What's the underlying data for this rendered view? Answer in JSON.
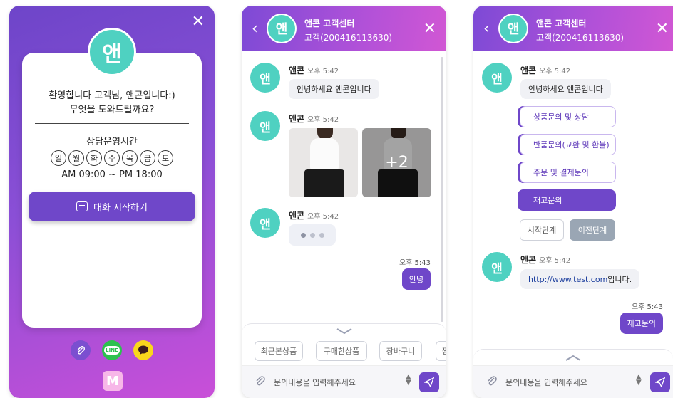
{
  "welcome_panel": {
    "avatar": "앤",
    "greeting_line1": "환영합니다 고객님, 앤콘입니다:)",
    "greeting_line2": "무엇을 도와드릴까요?",
    "hours_title": "상담운영시간",
    "days": [
      "일",
      "월",
      "화",
      "수",
      "목",
      "금",
      "토"
    ],
    "hours": "AM 09:00 ~ PM 18:00",
    "start_button": "대화 시작하기",
    "close_icon": "close-icon",
    "line_label": "LINE",
    "logo": "M"
  },
  "chat_header": {
    "avatar": "앤",
    "name": "앤콘 고객센터",
    "sub": "고객(200416113630)"
  },
  "chat1": {
    "sender": "앤콘",
    "m1_time": "오후 5:42",
    "m1_text": "안녕하세요 앤콘입니다",
    "m2_time": "오후 5:42",
    "more_photos": "+2",
    "m3_time": "오후 5:42",
    "mine_time": "오후 5:43",
    "mine_text": "안녕",
    "quick_chips": [
      "최근본상품",
      "구매한상품",
      "장바구니",
      "찜"
    ],
    "input_placeholder": "문의내용을 입력해주세요"
  },
  "chat2": {
    "sender": "앤콘",
    "m1_time": "오후 5:42",
    "m1_text": "안녕하세요 앤콘입니다",
    "options": [
      "상품문의 및 상담",
      "반품문의(교환 및 환불)",
      "주문 및 결제문의",
      "재고문의"
    ],
    "back_to_start": "시작단계",
    "prev_step": "이전단계",
    "m2_time": "오후 5:42",
    "link_text": "http://www.test.com",
    "link_suffix": " 입니다.",
    "mine_time": "오후 5:43",
    "mine_text": "재고문의",
    "input_placeholder": "문의내용을 입력해주세요"
  },
  "colors": {
    "accent": "#6f47c9",
    "avatar": "#4fd1c1",
    "gradient_end": "#d157d4"
  }
}
